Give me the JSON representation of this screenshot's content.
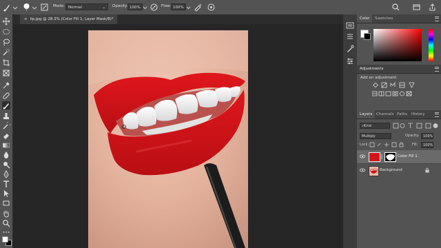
{
  "options_bar": {
    "brush_size": "1",
    "mode_label": "Mode:",
    "mode_value": "Normal",
    "opacity_label": "Opacity:",
    "opacity_value": "100%",
    "flow_label": "Flow:",
    "flow_value": "100%",
    "icons": [
      "brush-tool-icon",
      "brush-preset-icon",
      "brush-panel-icon",
      "pressure-opacity-icon",
      "airbrush-icon",
      "pressure-size-icon",
      "search-icon",
      "workspace-icon",
      "share-icon"
    ]
  },
  "document_tab": {
    "title": "lip.jpg @ 28.3% (Color Fill 1, Layer Mask/8)",
    "modified_marker": "*",
    "close_glyph": "×"
  },
  "panels": {
    "color": {
      "tabs": [
        "Color",
        "Swatches"
      ],
      "active": "Color",
      "foreground": "#ffffff",
      "background": "#000000",
      "hue_color": "#ff0000"
    },
    "adjustments": {
      "title": "Adjustments",
      "prompt": "Add an adjustment"
    },
    "layers": {
      "tabs": [
        "Layers",
        "Channels",
        "Paths",
        "History"
      ],
      "active": "Layers",
      "filter_label": "Kind",
      "blend_mode": "Multiply",
      "opacity_label": "Opacity:",
      "opacity_value": "100%",
      "lock_label": "Lock:",
      "fill_label": "Fill:",
      "fill_value": "100%",
      "items": [
        {
          "name": "Color Fill 1",
          "fill_color": "#d2141a",
          "selected": true
        },
        {
          "name": "Background",
          "selected": false
        }
      ]
    }
  },
  "colors": {
    "ui_panel": "#535353",
    "lip_red": "#d2141a"
  }
}
